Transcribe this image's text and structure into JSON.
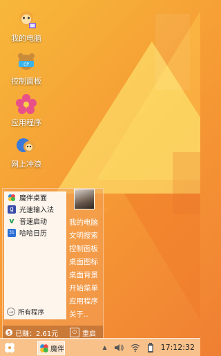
{
  "desktop": {
    "icons": [
      {
        "label": "我的电脑",
        "icon": "monkey-computer-icon"
      },
      {
        "label": "控制面板",
        "icon": "bear-control-panel-icon"
      },
      {
        "label": "应用程序",
        "icon": "flower-apps-icon"
      },
      {
        "label": "网上冲浪",
        "icon": "monkey-surf-icon"
      }
    ]
  },
  "start_menu": {
    "apps": [
      {
        "label": "魔伴桌面",
        "icon": "mobun-desktop-icon",
        "color": "#2a8bd8"
      },
      {
        "label": "光速输入法",
        "icon": "input-method-icon",
        "color": "#3a4ca8"
      },
      {
        "label": "音速启动",
        "icon": "launcher-v-icon",
        "color": "#1a9a4a"
      },
      {
        "label": "哈哈日历",
        "icon": "calendar-icon",
        "color": "#2b6fd6"
      }
    ],
    "all_programs": "所有程序",
    "right_items": [
      "我的电脑",
      "文明搜索",
      "控制面板",
      "桌面图标",
      "桌面背景",
      "开始菜单",
      "应用程序",
      "关于.."
    ],
    "earned": "已赚：2.61元",
    "restart": "重启"
  },
  "taskbar": {
    "task_label": "魔伴",
    "clock": "17:12:32"
  },
  "colors": {
    "accent": "#f59434",
    "taskbar": "#f8c896"
  }
}
